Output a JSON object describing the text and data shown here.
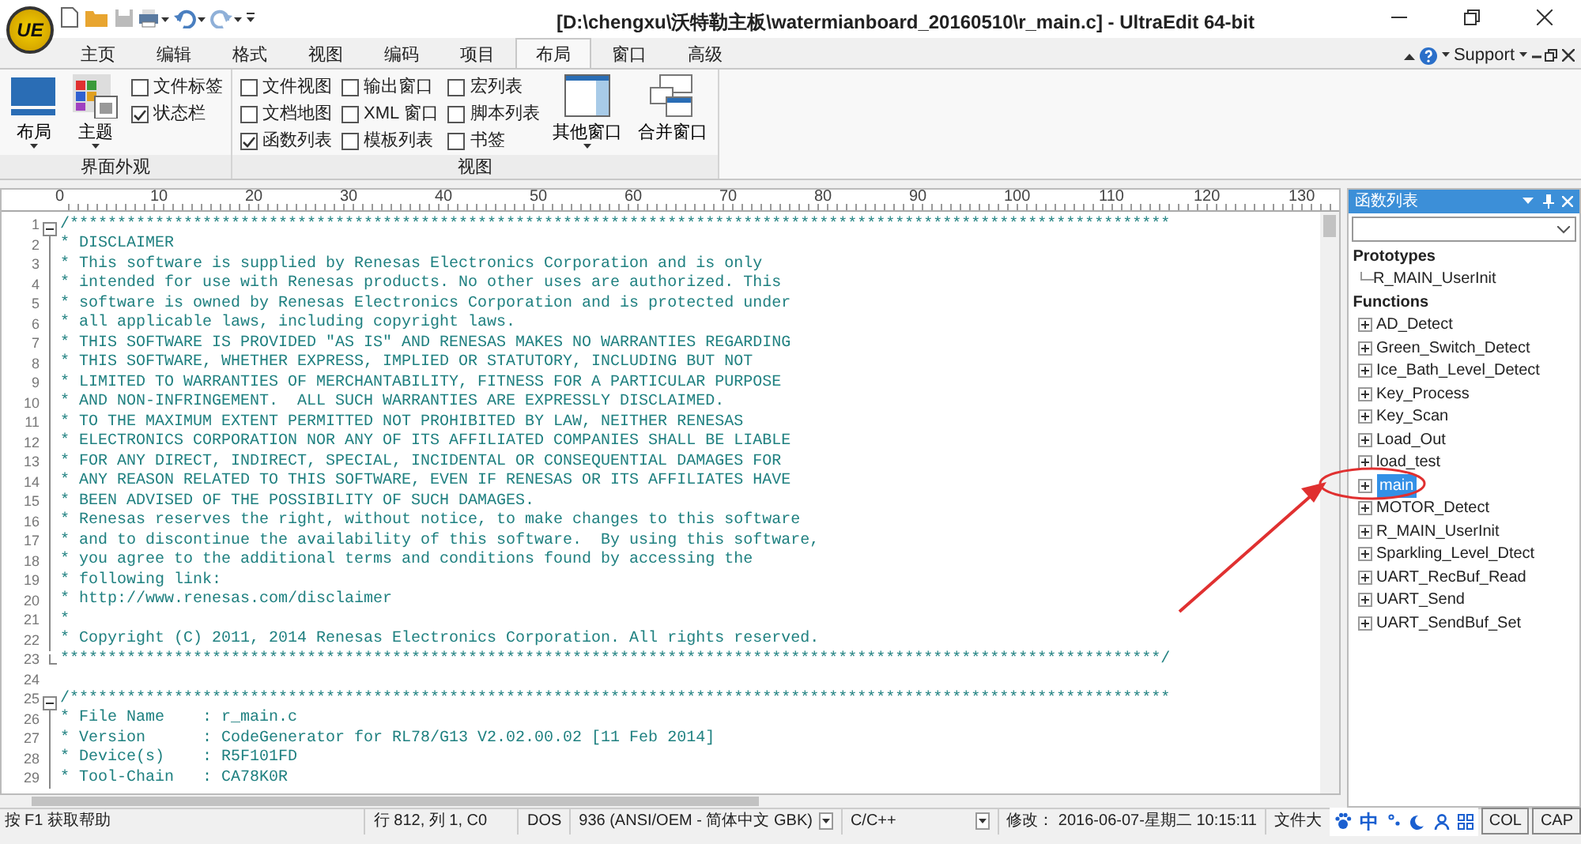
{
  "window": {
    "logo": "UE",
    "title": "[D:\\chengxu\\沃特勒主板\\watermianboard_20160510\\r_main.c] - UltraEdit 64-bit"
  },
  "ribbon": {
    "tabs": [
      {
        "label": "主页",
        "selected": false
      },
      {
        "label": "编辑",
        "selected": false
      },
      {
        "label": "格式",
        "selected": false
      },
      {
        "label": "视图",
        "selected": false
      },
      {
        "label": "编码",
        "selected": false
      },
      {
        "label": "项目",
        "selected": false
      },
      {
        "label": "布局",
        "selected": true
      },
      {
        "label": "窗口",
        "selected": false
      },
      {
        "label": "高级",
        "selected": false
      }
    ],
    "support": "Support",
    "groups": [
      {
        "title": "界面外观",
        "items": [
          {
            "kind": "large",
            "label": "布局",
            "dropdown": true
          },
          {
            "kind": "large",
            "label": "主题",
            "dropdown": true
          },
          {
            "kind": "checks",
            "checks": [
              {
                "label": "文件标签",
                "checked": false
              },
              {
                "label": "状态栏",
                "checked": true
              }
            ]
          }
        ]
      },
      {
        "title": "视图",
        "items": [
          {
            "kind": "checks",
            "checks": [
              {
                "label": "文件视图",
                "checked": false
              },
              {
                "label": "文档地图",
                "checked": false
              },
              {
                "label": "函数列表",
                "checked": true
              }
            ]
          },
          {
            "kind": "checks",
            "checks": [
              {
                "label": "输出窗口",
                "checked": false
              },
              {
                "label": "XML 窗口",
                "checked": false
              },
              {
                "label": "模板列表",
                "checked": false
              }
            ]
          },
          {
            "kind": "checks",
            "checks": [
              {
                "label": "宏列表",
                "checked": false
              },
              {
                "label": "脚本列表",
                "checked": false
              },
              {
                "label": "书签",
                "checked": false
              }
            ]
          },
          {
            "kind": "large",
            "label": "其他窗口",
            "dropdown": true
          },
          {
            "kind": "large",
            "label": "合并窗口",
            "dropdown": false
          }
        ]
      }
    ]
  },
  "editor": {
    "ruler": [
      "0",
      "10",
      "20",
      "30",
      "40",
      "50",
      "60",
      "70",
      "80",
      "90",
      "100",
      "110",
      "120",
      "130"
    ],
    "lines": [
      {
        "number": "1",
        "text": "/********************************************************************************************************************",
        "expanded": true
      },
      {
        "number": "2",
        "text": "* DISCLAIMER"
      },
      {
        "number": "3",
        "text": "* This software is supplied by Renesas Electronics Corporation and is only"
      },
      {
        "number": "4",
        "text": "* intended for use with Renesas products. No other uses are authorized. This"
      },
      {
        "number": "5",
        "text": "* software is owned by Renesas Electronics Corporation and is protected under"
      },
      {
        "number": "6",
        "text": "* all applicable laws, including copyright laws."
      },
      {
        "number": "7",
        "text": "* THIS SOFTWARE IS PROVIDED \"AS IS\" AND RENESAS MAKES NO WARRANTIES REGARDING"
      },
      {
        "number": "8",
        "text": "* THIS SOFTWARE, WHETHER EXPRESS, IMPLIED OR STATUTORY, INCLUDING BUT NOT"
      },
      {
        "number": "9",
        "text": "* LIMITED TO WARRANTIES OF MERCHANTABILITY, FITNESS FOR A PARTICULAR PURPOSE"
      },
      {
        "number": "10",
        "text": "* AND NON-INFRINGEMENT.  ALL SUCH WARRANTIES ARE EXPRESSLY DISCLAIMED."
      },
      {
        "number": "11",
        "text": "* TO THE MAXIMUM EXTENT PERMITTED NOT PROHIBITED BY LAW, NEITHER RENESAS"
      },
      {
        "number": "12",
        "text": "* ELECTRONICS CORPORATION NOR ANY OF ITS AFFILIATED COMPANIES SHALL BE LIABLE"
      },
      {
        "number": "13",
        "text": "* FOR ANY DIRECT, INDIRECT, SPECIAL, INCIDENTAL OR CONSEQUENTIAL DAMAGES FOR"
      },
      {
        "number": "14",
        "text": "* ANY REASON RELATED TO THIS SOFTWARE, EVEN IF RENESAS OR ITS AFFILIATES HAVE"
      },
      {
        "number": "15",
        "text": "* BEEN ADVISED OF THE POSSIBILITY OF SUCH DAMAGES."
      },
      {
        "number": "16",
        "text": "* Renesas reserves the right, without notice, to make changes to this software"
      },
      {
        "number": "17",
        "text": "* and to discontinue the availability of this software.  By using this software,"
      },
      {
        "number": "18",
        "text": "* you agree to the additional terms and conditions found by accessing the"
      },
      {
        "number": "19",
        "text": "* following link:"
      },
      {
        "number": "20",
        "text": "* http://www.renesas.com/disclaimer"
      },
      {
        "number": "21",
        "text": "*"
      },
      {
        "number": "22",
        "text": "* Copyright (C) 2011, 2014 Renesas Electronics Corporation. All rights reserved."
      },
      {
        "number": "23",
        "text": "********************************************************************************************************************/",
        "fold_end": true
      },
      {
        "number": "24"
      },
      {
        "number": "25",
        "text": "/********************************************************************************************************************",
        "expanded": true
      },
      {
        "number": "26",
        "text": "* File Name    : r_main.c"
      },
      {
        "number": "27",
        "text": "* Version      : CodeGenerator for RL78/G13 V2.02.00.02 [11 Feb 2014]"
      },
      {
        "number": "28",
        "text": "* Device(s)    : R5F101FD"
      },
      {
        "number": "29",
        "text": "* Tool-Chain   : CA78K0R"
      }
    ]
  },
  "function_list": {
    "title": "函数列表",
    "tree": [
      {
        "label": "Prototypes",
        "children": [
          {
            "label": "R_MAIN_UserInit",
            "selected": false
          }
        ]
      },
      {
        "label": "Functions",
        "children": [
          {
            "label": "AD_Detect",
            "expanded": false,
            "selected": false
          },
          {
            "label": "Green_Switch_Detect",
            "expanded": false,
            "selected": false
          },
          {
            "label": "Ice_Bath_Level_Detect",
            "expanded": false,
            "selected": false
          },
          {
            "label": "Key_Process",
            "expanded": false,
            "selected": false
          },
          {
            "label": "Key_Scan",
            "expanded": false,
            "selected": false
          },
          {
            "label": "Load_Out",
            "expanded": false,
            "selected": false
          },
          {
            "label": "load_test",
            "expanded": false,
            "selected": false
          },
          {
            "label": "main",
            "expanded": false,
            "selected": true
          },
          {
            "label": "MOTOR_Detect",
            "expanded": false,
            "selected": false
          },
          {
            "label": "R_MAIN_UserInit",
            "expanded": false,
            "selected": false
          },
          {
            "label": "Sparkling_Level_Dtect",
            "expanded": false,
            "selected": false
          },
          {
            "label": "UART_RecBuf_Read",
            "expanded": false,
            "selected": false
          },
          {
            "label": "UART_Send",
            "expanded": false,
            "selected": false
          },
          {
            "label": "UART_SendBuf_Set",
            "expanded": false,
            "selected": false
          }
        ]
      }
    ]
  },
  "status_bar": {
    "help": "按 F1 获取帮助",
    "position": "行 812, 列 1, C0",
    "line_ending": "DOS",
    "encoding": "936  (ANSI/OEM - 简体中文 GBK)",
    "language": "C/C++",
    "modified": "修改： 2016-06-07-星期二 10:15:11",
    "file_size": "文件大",
    "ime": "中",
    "keys": [
      "COL",
      "CAP"
    ]
  }
}
